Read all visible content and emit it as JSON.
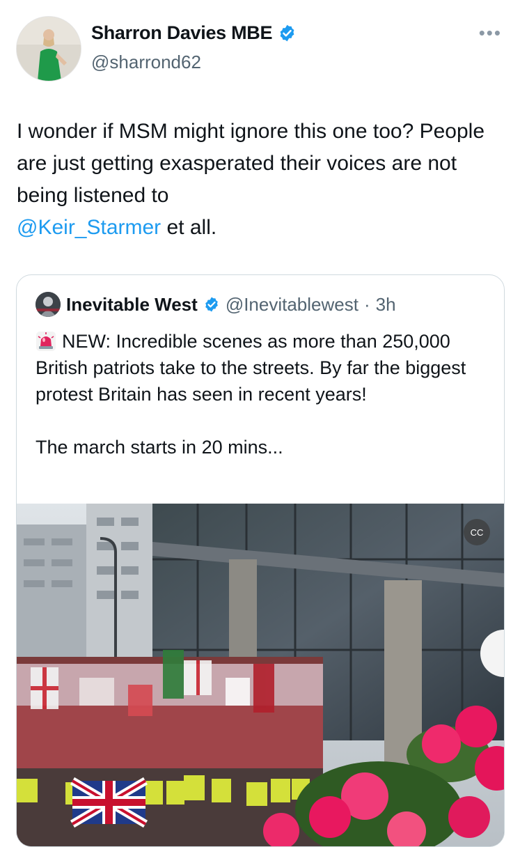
{
  "author": {
    "name": "Sharron Davies MBE",
    "handle": "@sharrond62",
    "avatar_icon": "profile-photo",
    "more_icon": "more-horizontal-icon"
  },
  "tweet": {
    "text_before_mention": "I wonder if MSM might ignore this one too? People are just getting exasperated their voices are not being listened to",
    "mention": "@Keir_Starmer",
    "text_after_mention": " et all."
  },
  "quoted_tweet": {
    "name": "Inevitable West",
    "handle": "@Inevitablewest",
    "separator": "·",
    "time": "3h",
    "line1": "NEW: Incredible scenes as more than 250,000 British patriots take to the streets. By far the biggest protest Britain has seen in recent years!",
    "line2": "The march starts in 20 mins...",
    "media_badge": "CC"
  },
  "colors": {
    "link": "#1d9bf0",
    "verified": "#1d9bf0",
    "secondary_text": "#536471",
    "border": "#cfd9de"
  }
}
